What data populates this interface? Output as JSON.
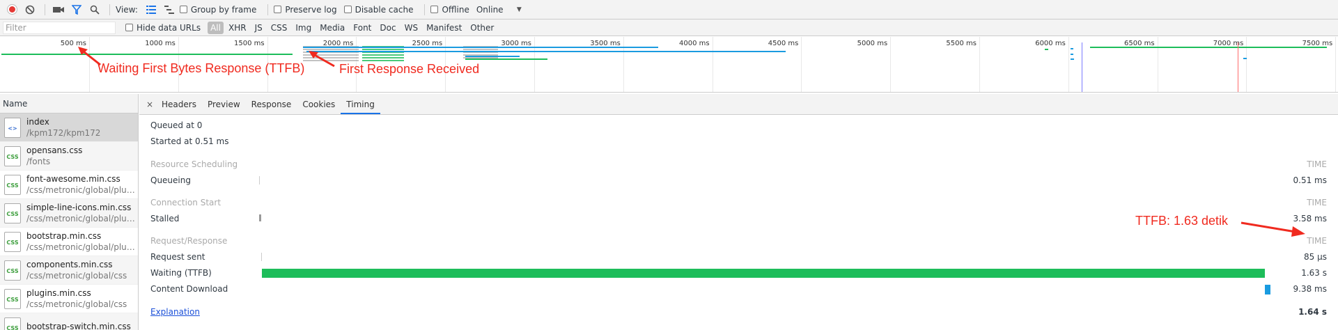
{
  "toolbar": {
    "view_label": "View:",
    "group_by_frame": "Group by frame",
    "preserve_log": "Preserve log",
    "disable_cache": "Disable cache",
    "offline": "Offline",
    "throttle_value": "Online",
    "icons": [
      "record-icon",
      "clear-icon",
      "camera-icon",
      "filter-icon",
      "search-icon",
      "list-view-icon",
      "waterfall-view-icon",
      "dropdown-icon"
    ],
    "accent": "#1a73e8",
    "record_color": "#e53935"
  },
  "filterbar": {
    "placeholder": "Filter",
    "hide_data_urls": "Hide data URLs",
    "types": [
      "All",
      "XHR",
      "JS",
      "CSS",
      "Img",
      "Media",
      "Font",
      "Doc",
      "WS",
      "Manifest",
      "Other"
    ],
    "active_type": "All"
  },
  "overview": {
    "ticks": [
      "500 ms",
      "1000 ms",
      "1500 ms",
      "2000 ms",
      "2500 ms",
      "3000 ms",
      "3500 ms",
      "4000 ms",
      "4500 ms",
      "5000 ms",
      "5500 ms",
      "6000 ms",
      "6500 ms",
      "7000 ms",
      "7500 ms"
    ]
  },
  "annotations": {
    "ttfb_wait": "Waiting First Bytes Response (TTFB)",
    "first_response": "First Response Received",
    "ttfb_value": "TTFB: 1.63 detik",
    "color": "#f02a1f"
  },
  "requests": {
    "header": "Name",
    "items": [
      {
        "name": "index",
        "path": "/kpm172/kpm172",
        "type": "html"
      },
      {
        "name": "opensans.css",
        "path": "/fonts",
        "type": "css"
      },
      {
        "name": "font-awesome.min.css",
        "path": "/css/metronic/global/plugi…",
        "type": "css"
      },
      {
        "name": "simple-line-icons.min.css",
        "path": "/css/metronic/global/plugi…",
        "type": "css"
      },
      {
        "name": "bootstrap.min.css",
        "path": "/css/metronic/global/plugi…",
        "type": "css"
      },
      {
        "name": "components.min.css",
        "path": "/css/metronic/global/css",
        "type": "css"
      },
      {
        "name": "plugins.min.css",
        "path": "/css/metronic/global/css",
        "type": "css"
      },
      {
        "name": "bootstrap-switch.min.css",
        "path": "",
        "type": "css"
      }
    ]
  },
  "details": {
    "close": "×",
    "tabs": [
      "Headers",
      "Preview",
      "Response",
      "Cookies",
      "Timing"
    ],
    "active_tab": "Timing",
    "queued": "Queued at 0",
    "started": "Started at 0.51 ms",
    "time_header": "TIME",
    "sections": {
      "scheduling": "Resource Scheduling",
      "connection": "Connection Start",
      "request": "Request/Response"
    },
    "rows": {
      "queueing": {
        "label": "Queueing",
        "value": "0.51 ms"
      },
      "stalled": {
        "label": "Stalled",
        "value": "3.58 ms"
      },
      "request_sent": {
        "label": "Request sent",
        "value": "85 μs"
      },
      "waiting": {
        "label": "Waiting (TTFB)",
        "value": "1.63 s"
      },
      "download": {
        "label": "Content Download",
        "value": "9.38 ms"
      }
    },
    "explanation": "Explanation",
    "total": "1.64 s",
    "colors": {
      "waiting": "#1dbd5a",
      "download": "#1a9be0",
      "stalled": "#999999"
    }
  }
}
